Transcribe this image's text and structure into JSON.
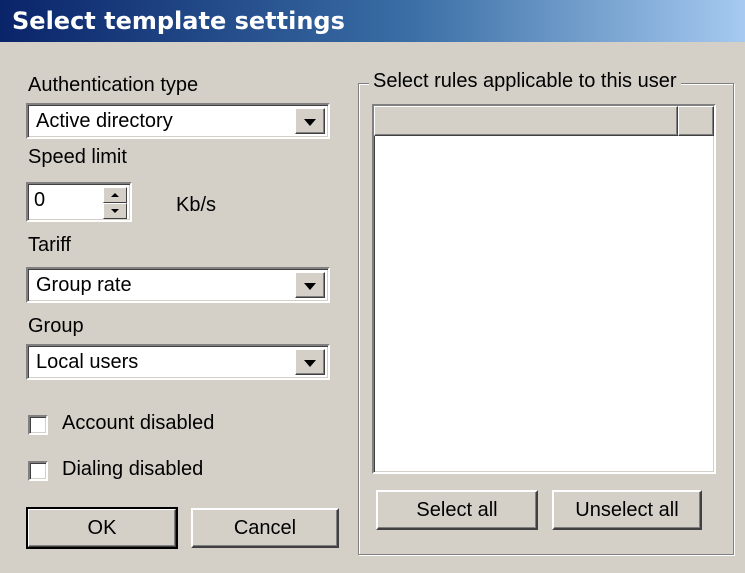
{
  "window": {
    "title": "Select template settings"
  },
  "form": {
    "auth_label": "Authentication type",
    "auth_value": "Active directory",
    "speed_label": "Speed limit",
    "speed_value": "0",
    "speed_unit": "Kb/s",
    "tariff_label": "Tariff",
    "tariff_value": "Group rate",
    "group_label": "Group",
    "group_value": "Local users",
    "account_disabled_label": "Account disabled",
    "account_disabled_checked": false,
    "dialing_disabled_label": "Dialing disabled",
    "dialing_disabled_checked": false
  },
  "rules": {
    "group_title": "Select rules applicable to this user",
    "select_all": "Select all",
    "unselect_all": "Unselect all"
  },
  "buttons": {
    "ok": "OK",
    "cancel": "Cancel"
  },
  "icons": {
    "dropdown": "chevron-down-icon",
    "spin_up": "spin-up-icon",
    "spin_down": "spin-down-icon"
  }
}
